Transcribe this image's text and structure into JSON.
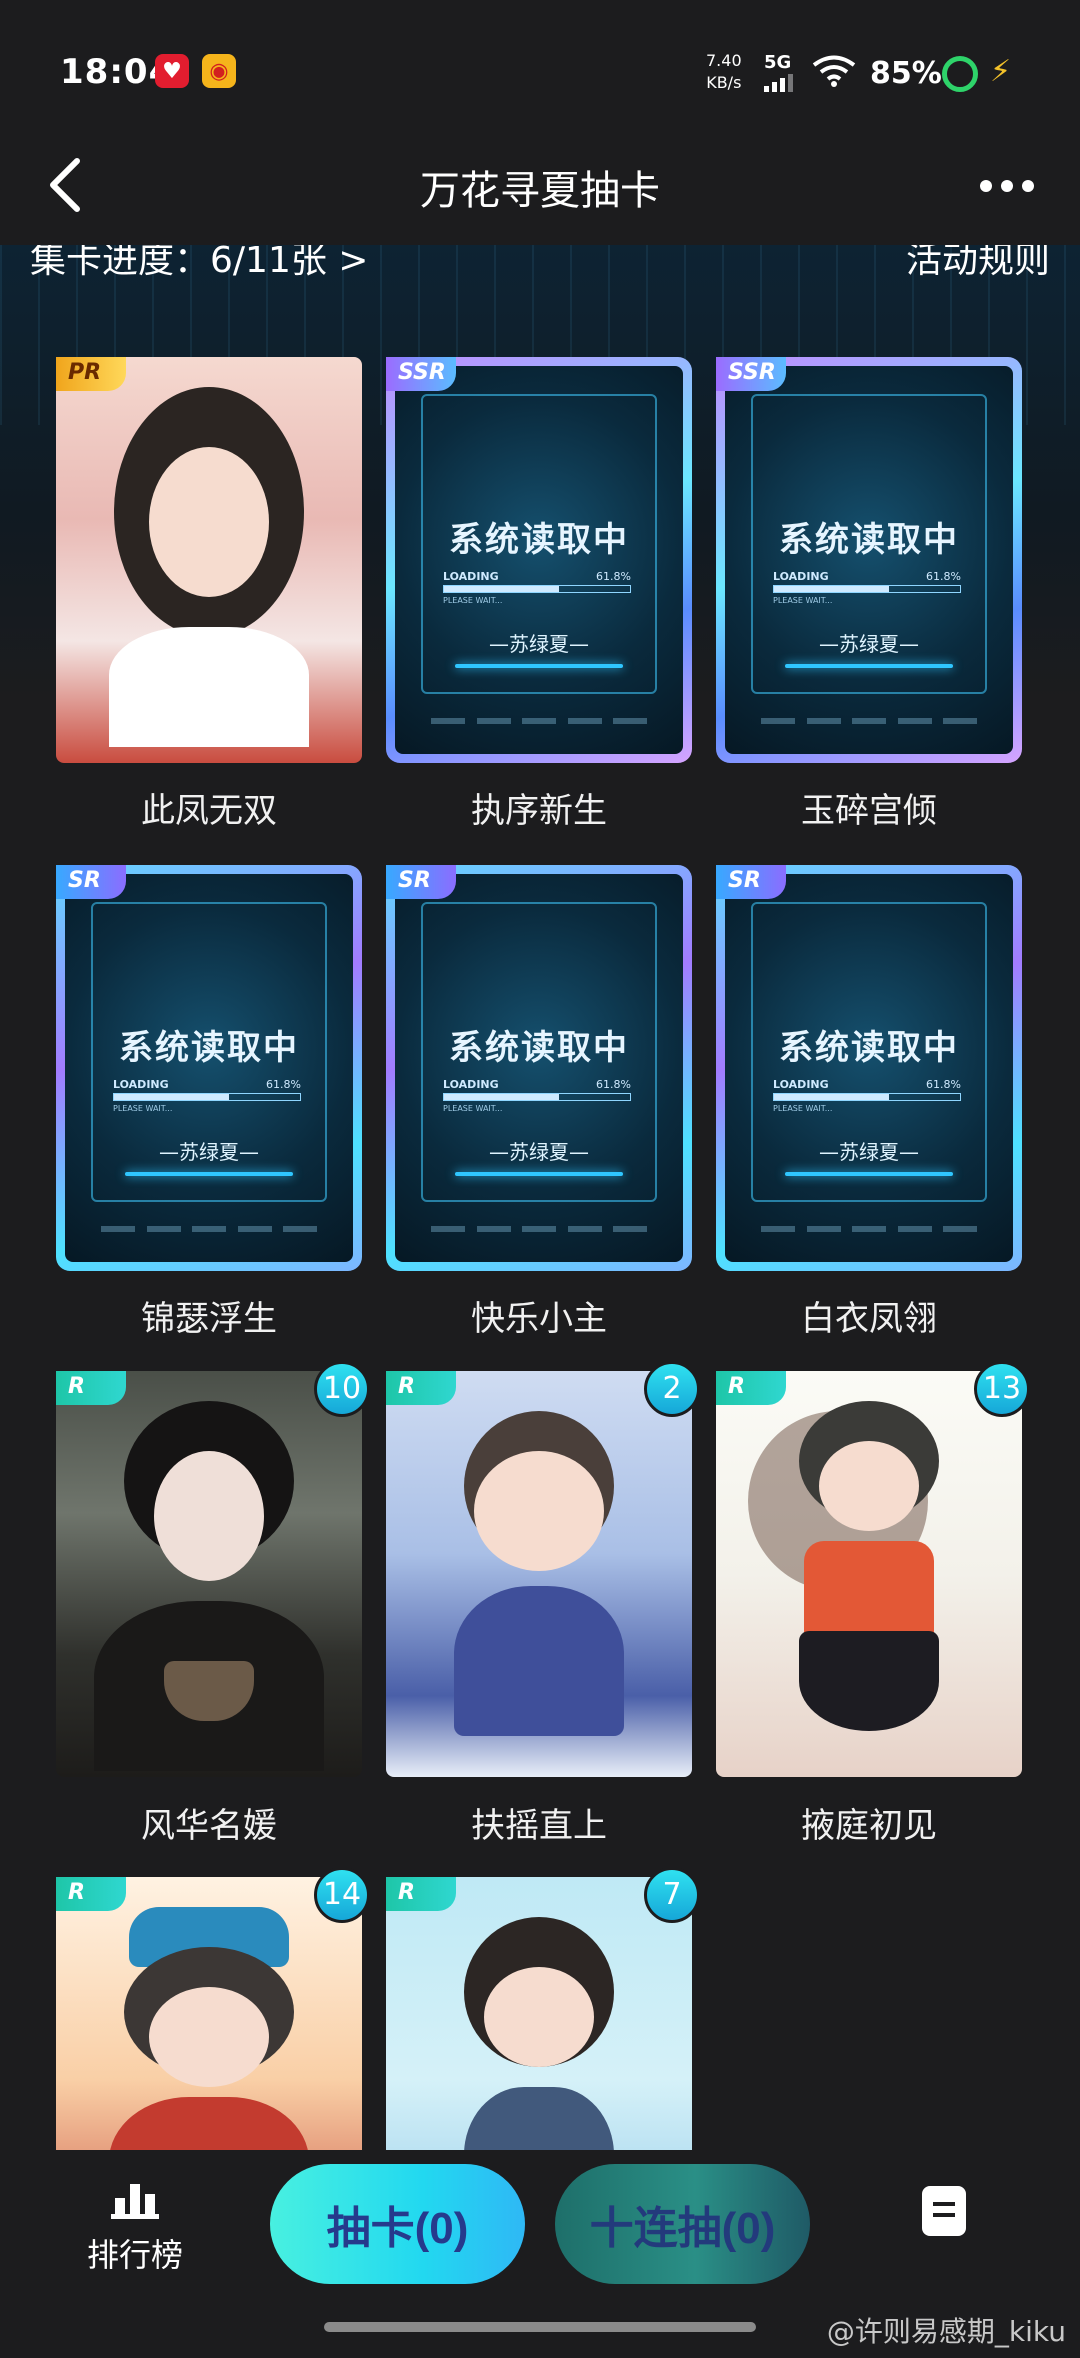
{
  "status_bar": {
    "time": "18:04",
    "net_speed_value": "7.40",
    "net_speed_unit": "KB/s",
    "signal_label": "5G",
    "battery": "85%"
  },
  "header": {
    "title": "万花寻夏抽卡"
  },
  "top_links": {
    "progress": "集卡进度：6/11张 >",
    "rules": "活动规则"
  },
  "loading_card": {
    "title": "系统读取中",
    "label": "LOADING",
    "percent": "61.8%",
    "progress": 0.618,
    "wait": "PLEASE WAIT...",
    "brand": "—苏绿夏—"
  },
  "cards": [
    {
      "name": "此凤无双",
      "rarity": "PR",
      "count": ""
    },
    {
      "name": "执序新生",
      "rarity": "SSR",
      "count": ""
    },
    {
      "name": "玉碎宫倾",
      "rarity": "SSR",
      "count": ""
    },
    {
      "name": "锦瑟浮生",
      "rarity": "SR",
      "count": ""
    },
    {
      "name": "快乐小主",
      "rarity": "SR",
      "count": ""
    },
    {
      "name": "白衣凤翎",
      "rarity": "SR",
      "count": ""
    },
    {
      "name": "风华名媛",
      "rarity": "R",
      "count": "10"
    },
    {
      "name": "扶摇直上",
      "rarity": "R",
      "count": "2"
    },
    {
      "name": "掖庭初见",
      "rarity": "R",
      "count": "13"
    },
    {
      "name": "",
      "rarity": "R",
      "count": "14"
    },
    {
      "name": "",
      "rarity": "R",
      "count": "7"
    }
  ],
  "bottom": {
    "ranking": "排行榜",
    "draw": "抽卡(0)",
    "ten_draw": "十连抽(0)"
  },
  "watermark": "@许则易感期_kiku",
  "colors": {
    "background": "#1c1c1e",
    "draw_button": "#22d8f0",
    "badge": "#2fe1f0"
  }
}
